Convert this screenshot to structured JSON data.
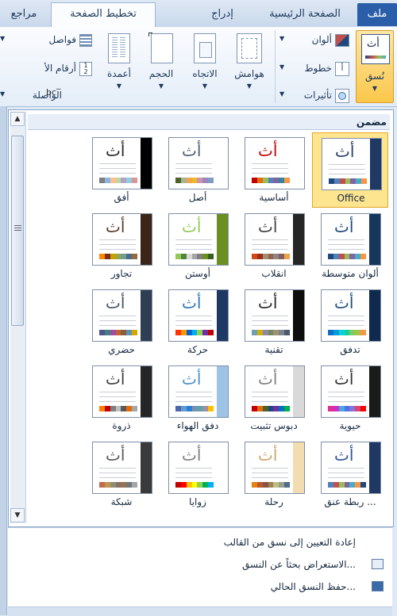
{
  "tabs": {
    "file": "ملف",
    "home": "الصفحة الرئيسية",
    "insert": "إدراج",
    "layout": "تخطيط الصفحة",
    "review": "مراجع"
  },
  "ribbon": {
    "themes": "نُسق",
    "colors": "ألوان",
    "fonts": "خطوط",
    "effects": "تأثيرات",
    "margins": "هوامش",
    "orientation": "الاتجاه",
    "size": "الحجم",
    "columns": "أعمدة",
    "breaks": "فواصل",
    "line_numbers": "أرقام الأ",
    "hyphenation": "الواصلة"
  },
  "gallery": {
    "section_title": "مضمن",
    "tiles": [
      {
        "label": "Office",
        "big": "أث",
        "dark": "#1f3864",
        "accent": "#243b6b",
        "swatches": [
          "#1f497d",
          "#4f81bd",
          "#c0504d",
          "#9bbb59",
          "#8064a2",
          "#4bacc6",
          "#f79646"
        ],
        "selected": true
      },
      {
        "label": "أساسية",
        "big": "أث",
        "dark": "#ffffff",
        "accent": "#c00000",
        "swatches": [
          "#c00000",
          "#e46c0a",
          "#9bbb59",
          "#4f81bd",
          "#8064a2",
          "#31859c",
          "#f79646"
        ],
        "selected": false
      },
      {
        "label": "أصل",
        "big": "أث",
        "dark": "#ffffff",
        "accent": "#4f5d73",
        "swatches": [
          "#4f6228",
          "#a5b592",
          "#f3a447",
          "#e7bc29",
          "#d092a7",
          "#9c85c0",
          "#809ec2"
        ],
        "selected": false
      },
      {
        "label": "أفق",
        "big": "أث",
        "dark": "#000000",
        "accent": "#262626",
        "swatches": [
          "#7f7f7f",
          "#8db3e2",
          "#fac08f",
          "#c3d69b",
          "#b2a2c7",
          "#93cddd",
          "#d99694"
        ],
        "selected": false
      },
      {
        "label": "ألوان متوسطة",
        "big": "أث",
        "dark": "#17365d",
        "accent": "#1f497d",
        "swatches": [
          "#1f497d",
          "#4f81bd",
          "#c0504d",
          "#9bbb59",
          "#8064a2",
          "#4bacc6",
          "#f79646"
        ],
        "selected": false
      },
      {
        "label": "انقلاب",
        "big": "أث",
        "dark": "#262626",
        "accent": "#404040",
        "swatches": [
          "#d34817",
          "#9b2d1f",
          "#a28e6a",
          "#956251",
          "#918485",
          "#855d5d",
          "#e9a44c"
        ],
        "selected": false
      },
      {
        "label": "أوستن",
        "big": "أث",
        "dark": "#6b8f23",
        "accent": "#94c954",
        "swatches": [
          "#94c954",
          "#4e8542",
          "#d9d9d9",
          "#a5a5a5",
          "#7f7f7f",
          "#6b8f23",
          "#3b5d1f"
        ],
        "selected": false
      },
      {
        "label": "تجاور",
        "big": "أث",
        "dark": "#3b2418",
        "accent": "#5a3a28",
        "swatches": [
          "#ff8600",
          "#7f2d1b",
          "#c4a000",
          "#98a64b",
          "#6d9f8f",
          "#4a6b8a",
          "#966a3d"
        ],
        "selected": false
      },
      {
        "label": "تدفق",
        "big": "أث",
        "dark": "#0f2a4d",
        "accent": "#1f4e79",
        "swatches": [
          "#0f6fc6",
          "#009dd9",
          "#0bd0d9",
          "#10cf9b",
          "#7cca62",
          "#a5c249",
          "#f79646"
        ],
        "selected": false
      },
      {
        "label": "تقنية",
        "big": "أث",
        "dark": "#0d0d0d",
        "accent": "#262626",
        "swatches": [
          "#6ea0b0",
          "#ccaf0a",
          "#8d89a4",
          "#748560",
          "#9e9273",
          "#7e848d",
          "#4a5b6b"
        ],
        "selected": false
      },
      {
        "label": "حركة",
        "big": "أث",
        "dark": "#1f3864",
        "accent": "#2e75b6",
        "swatches": [
          "#ff3300",
          "#ff9900",
          "#0066cc",
          "#00b0f0",
          "#92d050",
          "#7030a0",
          "#c00000"
        ],
        "selected": false
      },
      {
        "label": "حضري",
        "big": "أث",
        "dark": "#2f3e52",
        "accent": "#44546a",
        "swatches": [
          "#53548a",
          "#438086",
          "#a04da3",
          "#c4652d",
          "#8b5d3d",
          "#5c92b5",
          "#d7a800"
        ],
        "selected": false
      },
      {
        "label": "حيوية",
        "big": "أث",
        "dark": "#1a1a1a",
        "accent": "#333333",
        "swatches": [
          "#e32d91",
          "#c830cc",
          "#4ea6dc",
          "#4775e7",
          "#8971e1",
          "#d54773",
          "#ff0000"
        ],
        "selected": false
      },
      {
        "label": "دبوس تثبيت",
        "big": "أث",
        "dark": "#d9d9d9",
        "accent": "#7f7f7f",
        "swatches": [
          "#c00000",
          "#e36c09",
          "#4f6228",
          "#1f497d",
          "#7030a0",
          "#0070c0",
          "#00b050"
        ],
        "selected": false
      },
      {
        "label": "دفق الهواء",
        "big": "أث",
        "dark": "#9dc3e6",
        "accent": "#4a90c8",
        "swatches": [
          "#4a66ac",
          "#629dd1",
          "#297fd5",
          "#7f8fa9",
          "#5aa2ae",
          "#9d90a0",
          "#ffc000"
        ],
        "selected": false
      },
      {
        "label": "ذروة",
        "big": "أث",
        "dark": "#262626",
        "accent": "#404040",
        "swatches": [
          "#ff8000",
          "#c00000",
          "#7f7f7f",
          "#bfbfbf",
          "#595959",
          "#e46c0a",
          "#a6a6a6"
        ],
        "selected": false
      },
      {
        "label": "ربطة عنق ...",
        "big": "أث",
        "dark": "#1f3864",
        "accent": "#2f5597",
        "swatches": [
          "#4f81bd",
          "#c0504d",
          "#9bbb59",
          "#8064a2",
          "#4bacc6",
          "#f79646",
          "#1f497d"
        ],
        "selected": false
      },
      {
        "label": "رحلة",
        "big": "أث",
        "dark": "#f2dcb0",
        "accent": "#c9a66b",
        "swatches": [
          "#e48312",
          "#bd582c",
          "#865640",
          "#9b8357",
          "#c2bc80",
          "#94a088",
          "#4e6b87"
        ],
        "selected": false
      },
      {
        "label": "زوايا",
        "big": "أث",
        "dark": "#ffffff",
        "accent": "#7f7f7f",
        "swatches": [
          "#c00000",
          "#ff0000",
          "#ffc000",
          "#ffff00",
          "#92d050",
          "#00b050",
          "#00b0f0"
        ],
        "selected": false
      },
      {
        "label": "شبكة",
        "big": "أث",
        "dark": "#3a3a3a",
        "accent": "#595959",
        "swatches": [
          "#c66951",
          "#bf974d",
          "#928b70",
          "#87706b",
          "#94734e",
          "#6f777d",
          "#a5a5a5"
        ],
        "selected": false
      }
    ]
  },
  "menu": {
    "reset": "إعادة التعيين إلى نسق من القالب",
    "browse": "الاستعراض بحثاً عن النسق...",
    "save": "حفظ النسق الحالي..."
  }
}
